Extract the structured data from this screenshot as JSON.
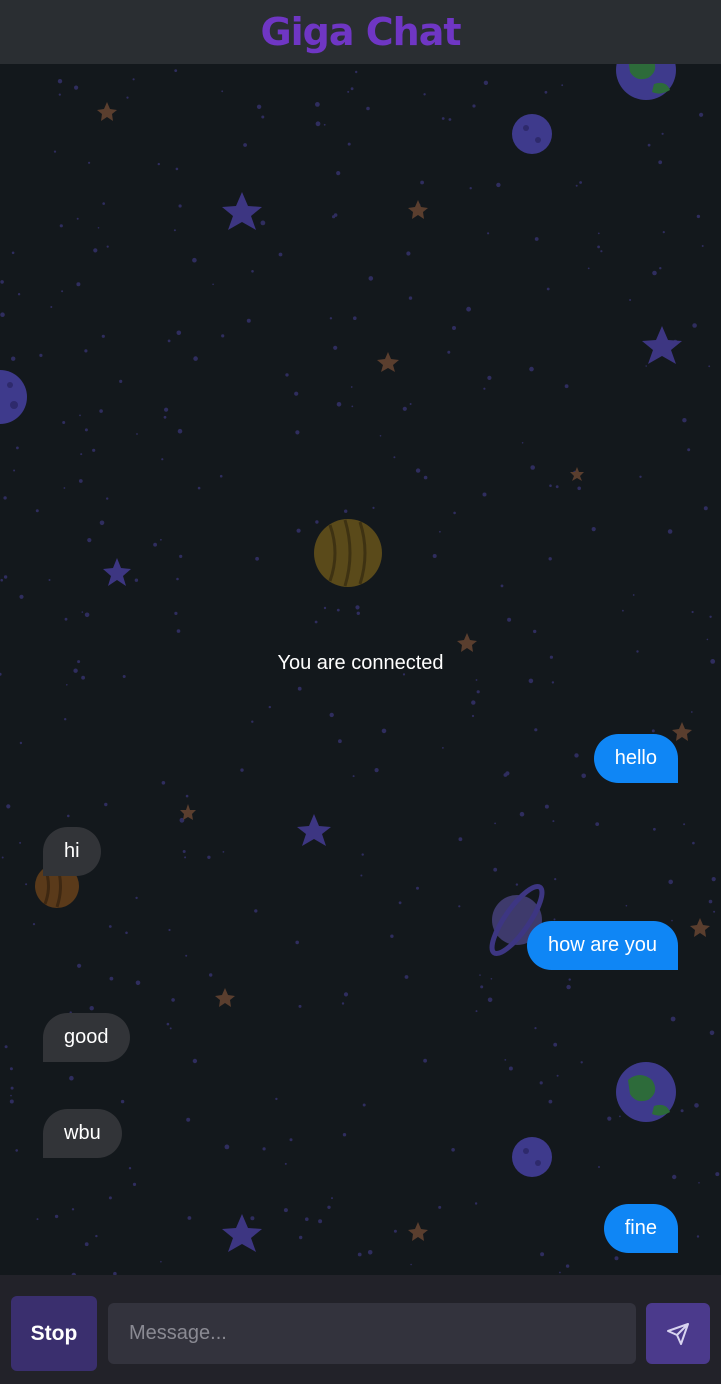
{
  "app": {
    "title": "Giga Chat"
  },
  "chat": {
    "system_message": "You are connected",
    "messages": [
      {
        "from": "me",
        "text": "hello"
      },
      {
        "from": "them",
        "text": "hi"
      },
      {
        "from": "me",
        "text": "how are you"
      },
      {
        "from": "them",
        "text": "good"
      },
      {
        "from": "them",
        "text": "wbu"
      },
      {
        "from": "me",
        "text": "fine"
      }
    ]
  },
  "composer": {
    "stop_label": "Stop",
    "placeholder": "Message...",
    "send_icon": "paper-plane-icon"
  },
  "colors": {
    "background": "#13181c",
    "header": "#2a2e32",
    "title": "#6f36c4",
    "my_bubble": "#0f86f5",
    "their_bubble": "#323438",
    "stop_button": "#3a2f6e",
    "send_button": "#4b3a8c"
  }
}
